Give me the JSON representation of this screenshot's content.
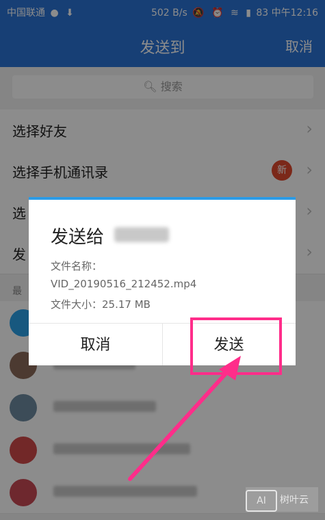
{
  "status": {
    "carrier": "中国联通",
    "speed": "502 B/s",
    "battery": "83",
    "time": "中午12:16",
    "icons": [
      "dot-icon",
      "download-icon",
      "mute-icon",
      "alarm-icon",
      "wifi-icon",
      "signal-icon",
      "battery-icon"
    ]
  },
  "header": {
    "title": "发送到",
    "cancel": "取消"
  },
  "search": {
    "placeholder": "搜索"
  },
  "rows": [
    {
      "label": "选择好友"
    },
    {
      "label": "选择手机通讯录",
      "badge": "新"
    },
    {
      "label": "选"
    },
    {
      "label": "发"
    }
  ],
  "section": {
    "recent_label": "最"
  },
  "dialog": {
    "title": "发送给",
    "file_name_label": "文件名称：",
    "file_name": "VID_20190516_212452.mp4",
    "file_size": "文件大小：25.17 MB",
    "cancel": "取消",
    "send": "发送"
  },
  "colors": {
    "header_blue": "#2b73d6",
    "dialog_accent": "#2b9be6",
    "highlight": "#ff2d8a",
    "badge": "#e04a2f"
  },
  "watermark": {
    "logo": "AI",
    "text": "树叶云"
  }
}
